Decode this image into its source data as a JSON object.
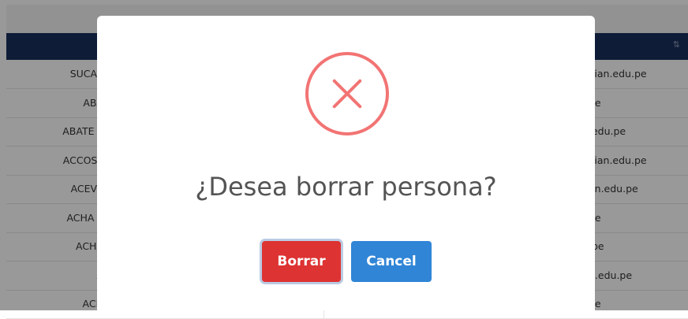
{
  "table": {
    "rows": [
      {
        "name": "SUCAS",
        "email": "vian.edu.pe"
      },
      {
        "name": "ABA",
        "email": "pe"
      },
      {
        "name": "ABATE P",
        "email": ".edu.pe"
      },
      {
        "name": "ACCOST",
        "email": "vian.edu.pe"
      },
      {
        "name": "ACEVE",
        "email": "an.edu.pe"
      },
      {
        "name": "ACHA P",
        "email": "pe"
      },
      {
        "name": "ACHA",
        "email": ".pe"
      },
      {
        "name": "A",
        "email": "n.edu.pe"
      },
      {
        "name": "ACH",
        "email": "pe"
      }
    ]
  },
  "modal": {
    "icon": "error-x-icon",
    "title": "¿Desea borrar persona?",
    "confirm_label": "Borrar",
    "cancel_label": "Cancel"
  },
  "colors": {
    "header": "#1a2f5e",
    "icon": "#f27474",
    "confirm": "#dd3333",
    "cancel": "#3085d6"
  }
}
